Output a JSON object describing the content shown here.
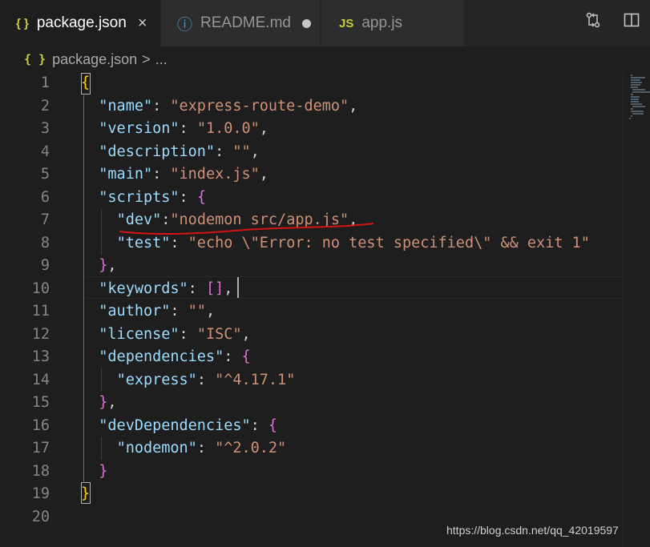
{
  "tabs": [
    {
      "icon": "{ }",
      "label": "package.json",
      "close": "×"
    },
    {
      "icon": "ⓘ",
      "label": "README.md"
    },
    {
      "icon": "JS",
      "label": "app.js"
    }
  ],
  "colors": {
    "json_icon": "#cbcb41",
    "info_icon": "#519aba",
    "js_icon": "#cbcb41",
    "annotation": "#d41414"
  },
  "breadcrumb": {
    "icon": "{ }",
    "file": "package.json",
    "sep": ">",
    "more": "..."
  },
  "lines": [
    {
      "n": "1",
      "t": [
        {
          "c": "b1",
          "v": "{"
        }
      ]
    },
    {
      "n": "2",
      "t": [
        {
          "c": "p",
          "v": "  "
        },
        {
          "c": "k",
          "v": "\"name\""
        },
        {
          "c": "p",
          "v": ": "
        },
        {
          "c": "s",
          "v": "\"express-route-demo\""
        },
        {
          "c": "p",
          "v": ","
        }
      ]
    },
    {
      "n": "3",
      "t": [
        {
          "c": "p",
          "v": "  "
        },
        {
          "c": "k",
          "v": "\"version\""
        },
        {
          "c": "p",
          "v": ": "
        },
        {
          "c": "s",
          "v": "\"1.0.0\""
        },
        {
          "c": "p",
          "v": ","
        }
      ]
    },
    {
      "n": "4",
      "t": [
        {
          "c": "p",
          "v": "  "
        },
        {
          "c": "k",
          "v": "\"description\""
        },
        {
          "c": "p",
          "v": ": "
        },
        {
          "c": "s",
          "v": "\"\""
        },
        {
          "c": "p",
          "v": ","
        }
      ]
    },
    {
      "n": "5",
      "t": [
        {
          "c": "p",
          "v": "  "
        },
        {
          "c": "k",
          "v": "\"main\""
        },
        {
          "c": "p",
          "v": ": "
        },
        {
          "c": "s",
          "v": "\"index.js\""
        },
        {
          "c": "p",
          "v": ","
        }
      ]
    },
    {
      "n": "6",
      "t": [
        {
          "c": "p",
          "v": "  "
        },
        {
          "c": "k",
          "v": "\"scripts\""
        },
        {
          "c": "p",
          "v": ": "
        },
        {
          "c": "b2",
          "v": "{"
        }
      ]
    },
    {
      "n": "7",
      "t": [
        {
          "c": "p",
          "v": "    "
        },
        {
          "c": "k",
          "v": "\"dev\""
        },
        {
          "c": "p",
          "v": ":"
        },
        {
          "c": "s",
          "v": "\"nodemon src/app.js\""
        },
        {
          "c": "p",
          "v": ","
        }
      ]
    },
    {
      "n": "8",
      "t": [
        {
          "c": "p",
          "v": "    "
        },
        {
          "c": "k",
          "v": "\"test\""
        },
        {
          "c": "p",
          "v": ": "
        },
        {
          "c": "s",
          "v": "\"echo \\\"Error: no test specified\\\" && exit 1\""
        }
      ]
    },
    {
      "n": "9",
      "t": [
        {
          "c": "p",
          "v": "  "
        },
        {
          "c": "b2",
          "v": "}"
        },
        {
          "c": "p",
          "v": ","
        }
      ]
    },
    {
      "n": "10",
      "t": [
        {
          "c": "p",
          "v": "  "
        },
        {
          "c": "k",
          "v": "\"keywords\""
        },
        {
          "c": "p",
          "v": ": "
        },
        {
          "c": "b2",
          "v": "[]"
        },
        {
          "c": "p",
          "v": ","
        }
      ]
    },
    {
      "n": "11",
      "t": [
        {
          "c": "p",
          "v": "  "
        },
        {
          "c": "k",
          "v": "\"author\""
        },
        {
          "c": "p",
          "v": ": "
        },
        {
          "c": "s",
          "v": "\"\""
        },
        {
          "c": "p",
          "v": ","
        }
      ]
    },
    {
      "n": "12",
      "t": [
        {
          "c": "p",
          "v": "  "
        },
        {
          "c": "k",
          "v": "\"license\""
        },
        {
          "c": "p",
          "v": ": "
        },
        {
          "c": "s",
          "v": "\"ISC\""
        },
        {
          "c": "p",
          "v": ","
        }
      ]
    },
    {
      "n": "13",
      "t": [
        {
          "c": "p",
          "v": "  "
        },
        {
          "c": "k",
          "v": "\"dependencies\""
        },
        {
          "c": "p",
          "v": ": "
        },
        {
          "c": "b2",
          "v": "{"
        }
      ]
    },
    {
      "n": "14",
      "t": [
        {
          "c": "p",
          "v": "    "
        },
        {
          "c": "k",
          "v": "\"express\""
        },
        {
          "c": "p",
          "v": ": "
        },
        {
          "c": "s",
          "v": "\"^4.17.1\""
        }
      ]
    },
    {
      "n": "15",
      "t": [
        {
          "c": "p",
          "v": "  "
        },
        {
          "c": "b2",
          "v": "}"
        },
        {
          "c": "p",
          "v": ","
        }
      ]
    },
    {
      "n": "16",
      "t": [
        {
          "c": "p",
          "v": "  "
        },
        {
          "c": "k",
          "v": "\"devDependencies\""
        },
        {
          "c": "p",
          "v": ": "
        },
        {
          "c": "b2",
          "v": "{"
        }
      ]
    },
    {
      "n": "17",
      "t": [
        {
          "c": "p",
          "v": "    "
        },
        {
          "c": "k",
          "v": "\"nodemon\""
        },
        {
          "c": "p",
          "v": ": "
        },
        {
          "c": "s",
          "v": "\"^2.0.2\""
        }
      ]
    },
    {
      "n": "18",
      "t": [
        {
          "c": "p",
          "v": "  "
        },
        {
          "c": "b2",
          "v": "}"
        }
      ]
    },
    {
      "n": "19",
      "t": [
        {
          "c": "b1",
          "v": "}"
        }
      ]
    },
    {
      "n": "20",
      "t": []
    }
  ],
  "watermark": "https://blog.csdn.net/qq_42019597"
}
